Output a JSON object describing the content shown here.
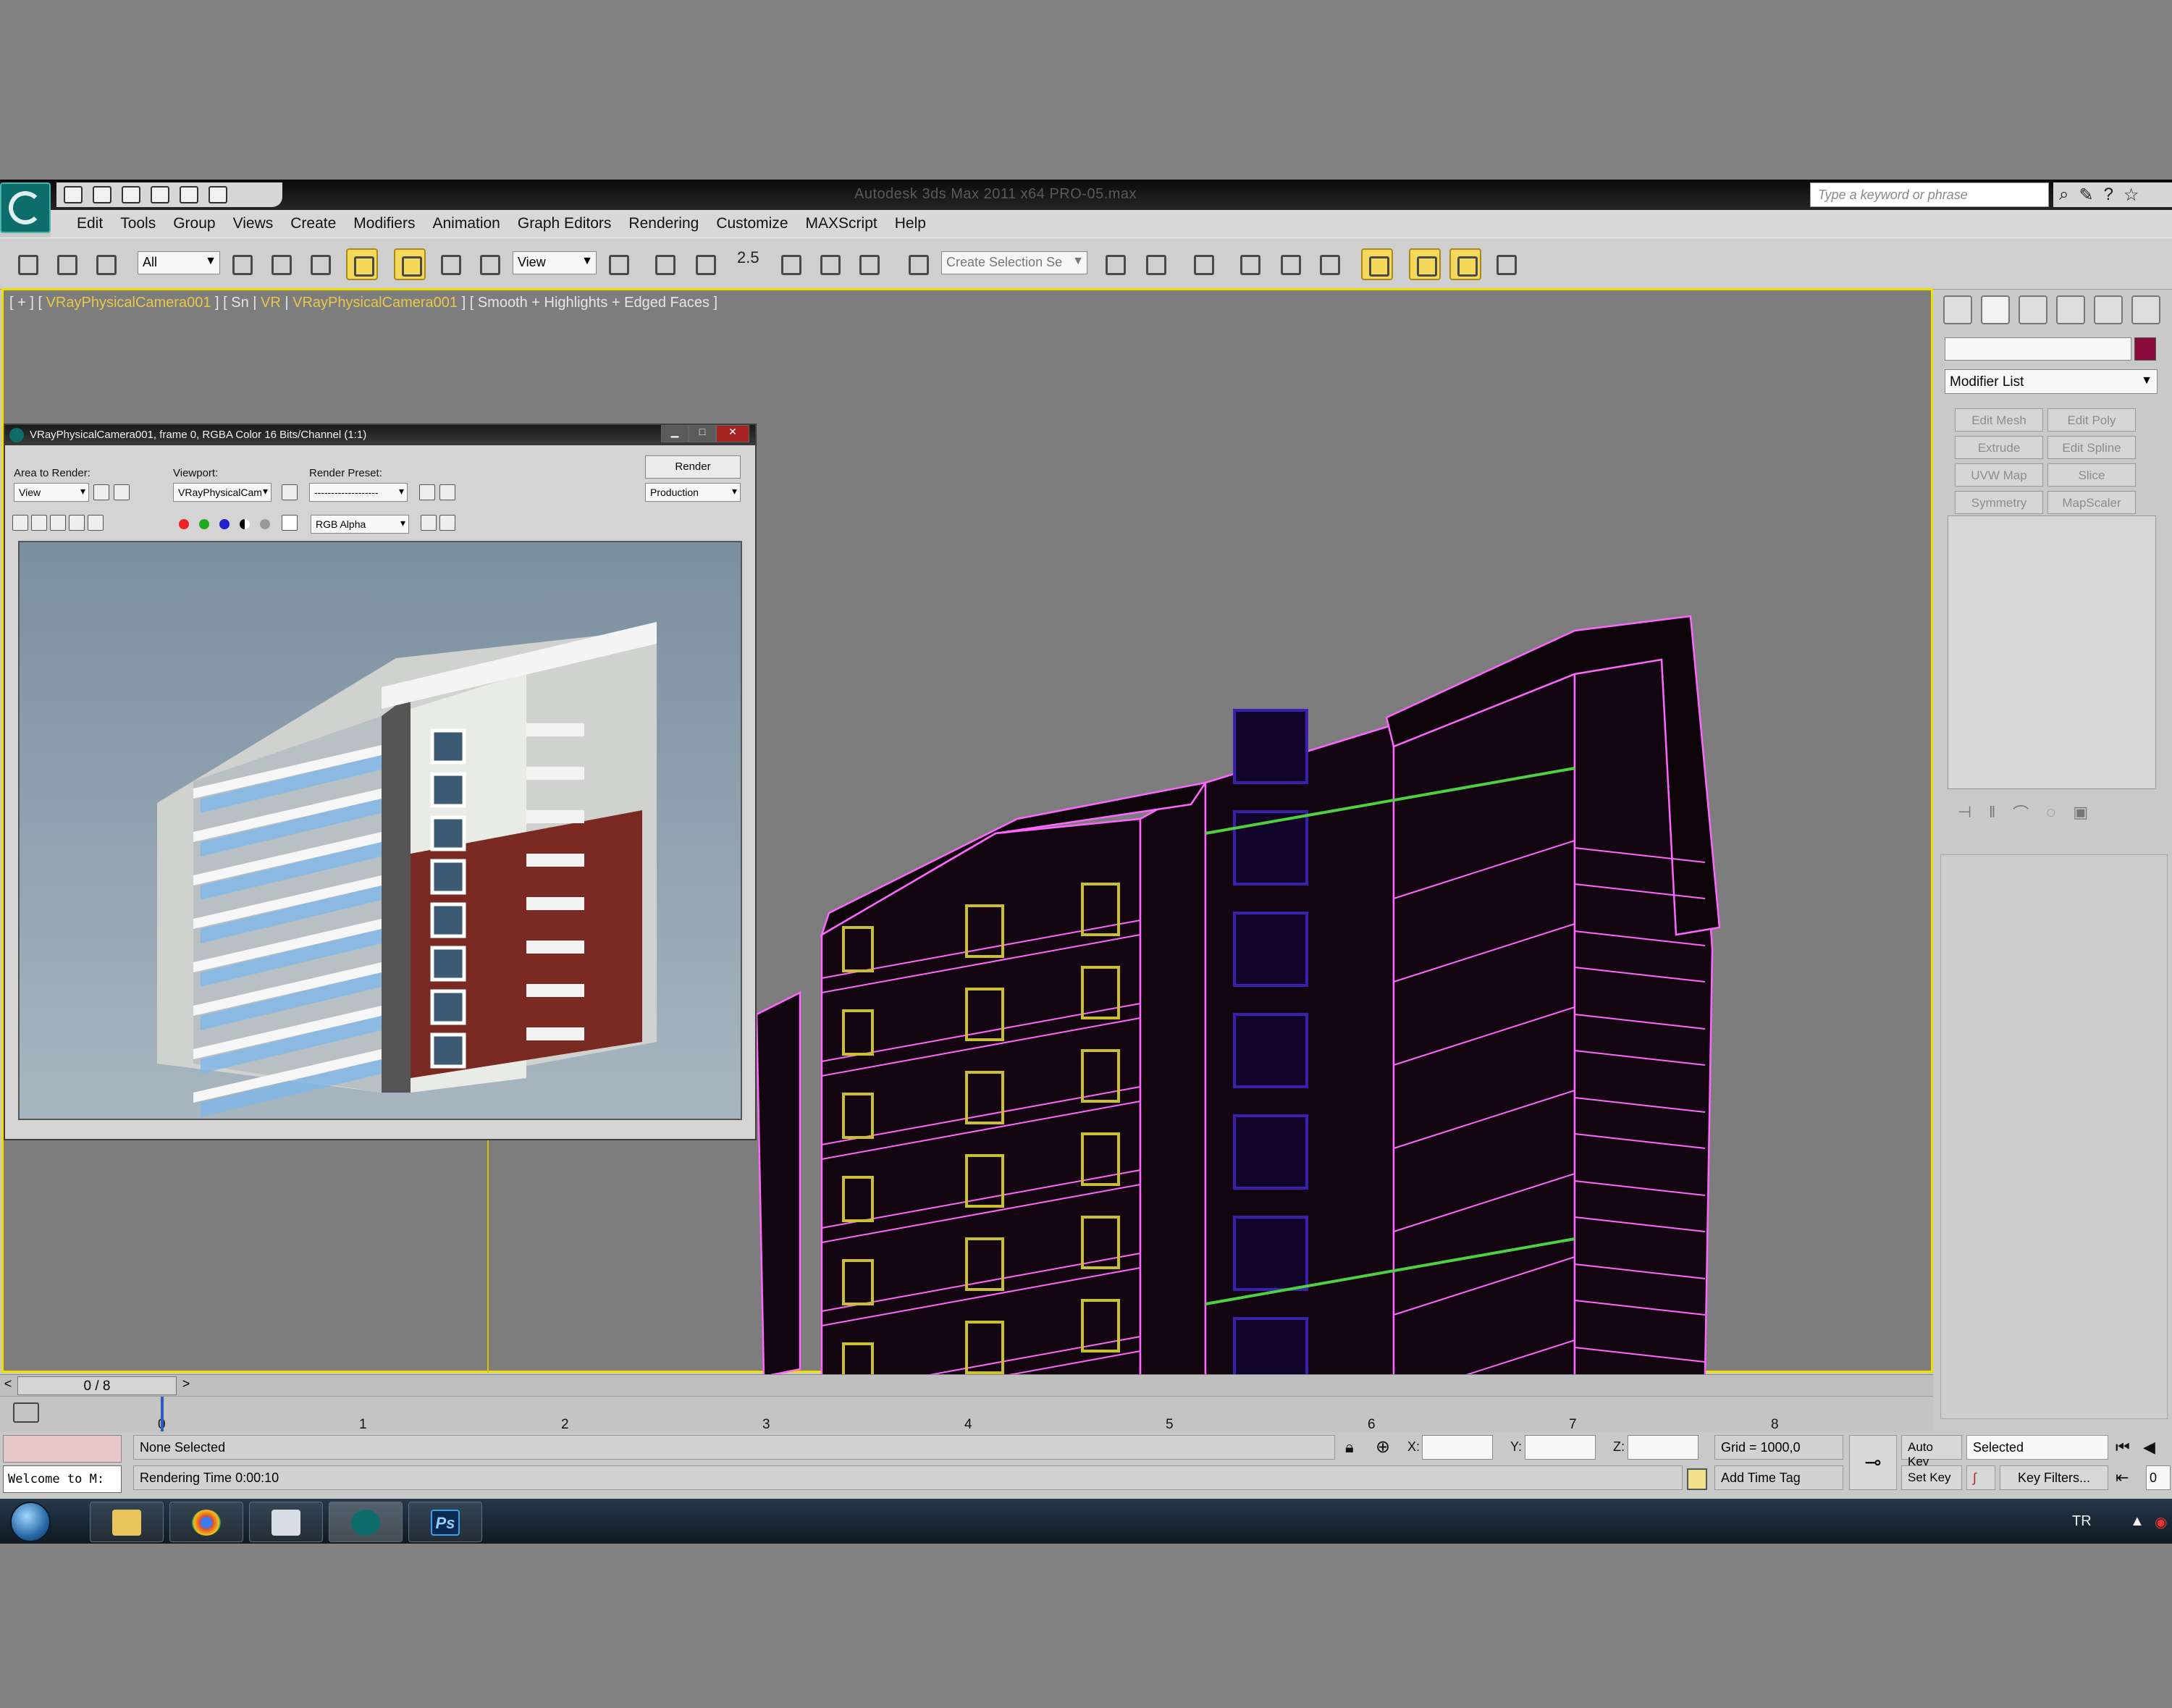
{
  "window": {
    "title": "Autodesk 3ds Max  2011 x64     PRO-05.max",
    "search_placeholder": "Type a keyword or phrase"
  },
  "menu": [
    "Edit",
    "Tools",
    "Group",
    "Views",
    "Create",
    "Modifiers",
    "Animation",
    "Graph Editors",
    "Rendering",
    "Customize",
    "MAXScript",
    "Help"
  ],
  "toolbar": {
    "selection_filter": "All",
    "ref_coord": "View",
    "snap_angle": "2.5",
    "named_selection_placeholder": "Create Selection Se"
  },
  "viewport": {
    "label_parts": [
      "[ + ] [ ",
      "VRayPhysicalCamera001",
      " ] [ Sn | ",
      "VR",
      " | ",
      "VRayPhysicalCamera001",
      " ] [ Smooth + Highlights + Edged Faces ]"
    ]
  },
  "render_frame": {
    "title": "VRayPhysicalCamera001, frame 0, RGBA Color 16 Bits/Channel (1:1)",
    "area_label": "Area to Render:",
    "area_value": "View",
    "viewport_label": "Viewport:",
    "viewport_value": "VRayPhysicalCam",
    "preset_label": "Render Preset:",
    "preset_value": "-------------------",
    "render_button": "Render",
    "mode_value": "Production",
    "channel_value": "RGB Alpha"
  },
  "command_panel": {
    "modifier_list": "Modifier List",
    "buttons": [
      "Edit Mesh",
      "Edit Poly",
      "Extrude",
      "Edit Spline",
      "UVW Map",
      "Slice",
      "Symmetry",
      "MapScaler"
    ]
  },
  "time": {
    "slider": "0 / 8",
    "ticks": [
      "0",
      "1",
      "2",
      "3",
      "4",
      "5",
      "6",
      "7",
      "8"
    ]
  },
  "status": {
    "welcome": "Welcome to M:",
    "selection": "None Selected",
    "render_time": "Rendering Time  0:00:10",
    "x_label": "X:",
    "y_label": "Y:",
    "z_label": "Z:",
    "grid": "Grid = 1000,0",
    "add_time_tag": "Add Time Tag",
    "auto_key": "Auto Key",
    "set_key": "Set Key",
    "selected_value": "Selected",
    "key_filters": "Key Filters...",
    "frame_value": "0"
  },
  "taskbar": {
    "language": "TR",
    "apps": [
      "file-explorer-icon",
      "chrome-icon",
      "calculator-icon",
      "3dsmax-icon",
      "photoshop-icon"
    ],
    "photoshop_label": "Ps"
  },
  "colors": {
    "wire_magenta": "#ff66ff",
    "viewport_bg": "#7d7d7d",
    "active_border": "#f0e000",
    "object_color": "#8a0a3c"
  }
}
